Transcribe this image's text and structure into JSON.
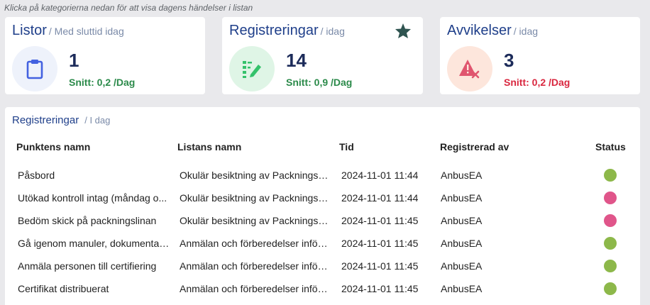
{
  "hint": "Klicka på kategorierna nedan för att visa dagens händelser i listan",
  "cards": {
    "listor": {
      "title": "Listor",
      "subtitle": "/ Med sluttid idag",
      "count": "1",
      "avg": "Snitt: 0,2 /Dag",
      "icon": "clipboard-icon",
      "circle_color": "#eef2fb",
      "icon_color": "#4361e0"
    },
    "registreringar": {
      "title": "Registreringar",
      "subtitle": "/ idag",
      "count": "14",
      "avg": "Snitt: 0,9 /Dag",
      "icon": "checklist-edit-icon",
      "circle_color": "#dff5e6",
      "icon_color": "#34c26b",
      "star_icon": "star-icon",
      "star_color": "#2f5450"
    },
    "avvikelser": {
      "title": "Avvikelser",
      "subtitle": "/ idag",
      "count": "3",
      "avg": "Snitt: 0,2 /Dag",
      "icon": "warning-x-icon",
      "circle_color": "#fde6dc",
      "icon_color": "#e0556f"
    }
  },
  "panel": {
    "title": "Registreringar",
    "subtitle": "/ I dag",
    "columns": [
      "Punktens namn",
      "Listans namn",
      "Tid",
      "Registrerad av",
      "Status"
    ],
    "rows": [
      {
        "name": "Påsbord",
        "list": "Okulär besiktning av Packningsli...",
        "time": "2024-11-01 11:44",
        "by": "AnbusEA",
        "status": "ok"
      },
      {
        "name": "Utökad kontroll intag (måndag o...",
        "list": "Okulär besiktning av Packningsli...",
        "time": "2024-11-01 11:44",
        "by": "AnbusEA",
        "status": "deviation"
      },
      {
        "name": "Bedöm skick på packningslinan",
        "list": "Okulär besiktning av Packningsli...",
        "time": "2024-11-01 11:45",
        "by": "AnbusEA",
        "status": "deviation"
      },
      {
        "name": "Gå igenom manuler, dokumentati...",
        "list": "Anmälan och förberedelser inför ...",
        "time": "2024-11-01 11:45",
        "by": "AnbusEA",
        "status": "ok"
      },
      {
        "name": "Anmäla personen till certifiering",
        "list": "Anmälan och förberedelser inför ...",
        "time": "2024-11-01 11:45",
        "by": "AnbusEA",
        "status": "ok"
      },
      {
        "name": "Certifikat distribuerat",
        "list": "Anmälan och förberedelser inför ...",
        "time": "2024-11-01 11:45",
        "by": "AnbusEA",
        "status": "ok"
      }
    ],
    "status_colors": {
      "ok": "#8db84a",
      "deviation": "#e0558a"
    }
  }
}
